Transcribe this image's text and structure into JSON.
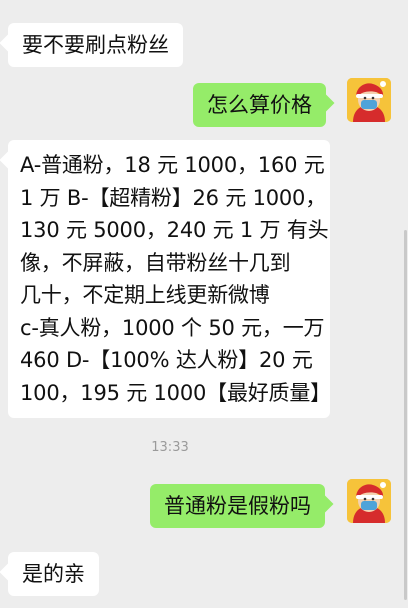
{
  "messages": [
    {
      "side": "in",
      "text": "要不要刷点粉丝"
    },
    {
      "side": "out",
      "text": "怎么算价格"
    },
    {
      "side": "in",
      "lines": [
        "A-普通粉，18 元 1000，160 元",
        "1 万 B-【超精粉】26 元 1000，",
        "130 元 5000，240 元 1 万 有头",
        "像，不屏蔽，自带粉丝十几到",
        "几十，不定期上线更新微博",
        "c-真人粉，1000 个 50 元，一万",
        "460 D-【100% 达人粉】20 元",
        "100，195 元 1000【最好质量】"
      ]
    },
    {
      "side": "out",
      "text": "普通粉是假粉吗"
    },
    {
      "side": "in",
      "text": "是的亲"
    }
  ],
  "timestamp": "13:33",
  "colors": {
    "background": "#ededed",
    "incoming_bubble": "#ffffff",
    "outgoing_bubble": "#95ec69",
    "avatar_bg": "#f6c33a",
    "avatar_hat": "#d62c2c",
    "avatar_mask": "#4fa3d9"
  }
}
